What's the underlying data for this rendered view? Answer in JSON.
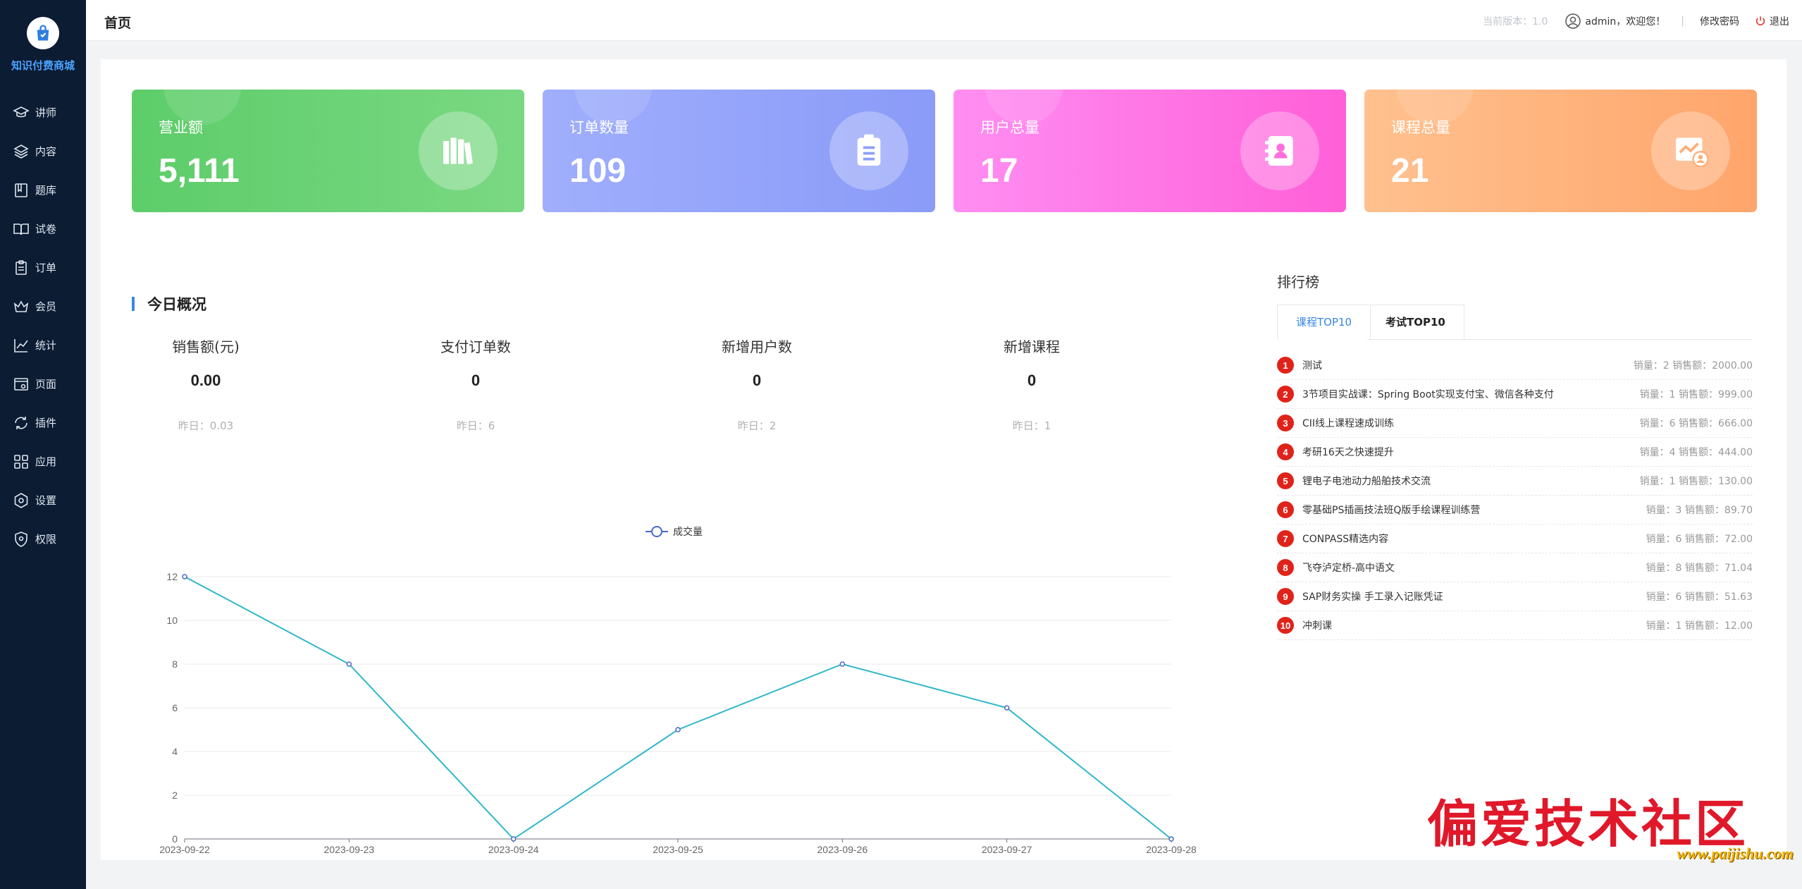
{
  "brand": {
    "name": "知识付费商城"
  },
  "sidebar": {
    "items": [
      {
        "label": "讲师",
        "icon": "graduation-cap-icon"
      },
      {
        "label": "内容",
        "icon": "layers-icon"
      },
      {
        "label": "题库",
        "icon": "book-icon"
      },
      {
        "label": "试卷",
        "icon": "open-book-icon"
      },
      {
        "label": "订单",
        "icon": "clipboard-icon"
      },
      {
        "label": "会员",
        "icon": "crown-icon"
      },
      {
        "label": "统计",
        "icon": "line-chart-icon"
      },
      {
        "label": "页面",
        "icon": "page-settings-icon"
      },
      {
        "label": "插件",
        "icon": "refresh-icon"
      },
      {
        "label": "应用",
        "icon": "apps-grid-icon"
      },
      {
        "label": "设置",
        "icon": "gear-icon"
      },
      {
        "label": "权限",
        "icon": "shield-icon"
      }
    ]
  },
  "header": {
    "title": "首页",
    "version": "当前版本：1.0",
    "user_greeting": "admin，欢迎您！",
    "separator": "|",
    "change_password": "修改密码",
    "logout": "退出"
  },
  "cards": [
    {
      "label": "营业额",
      "value": "5,111",
      "icon": "books-icon"
    },
    {
      "label": "订单数量",
      "value": "109",
      "icon": "clipboard-icon"
    },
    {
      "label": "用户总量",
      "value": "17",
      "icon": "contacts-icon"
    },
    {
      "label": "课程总量",
      "value": "21",
      "icon": "chart-user-icon"
    }
  ],
  "overview": {
    "title": "今日概况",
    "stats": [
      {
        "label": "销售额(元)",
        "value": "0.00",
        "yesterday": "昨日：0.03"
      },
      {
        "label": "支付订单数",
        "value": "0",
        "yesterday": "昨日：6"
      },
      {
        "label": "新增用户数",
        "value": "0",
        "yesterday": "昨日：2"
      },
      {
        "label": "新增课程",
        "value": "0",
        "yesterday": "昨日：1"
      }
    ]
  },
  "chart_data": {
    "type": "line",
    "x": [
      "2023-09-22",
      "2023-09-23",
      "2023-09-24",
      "2023-09-25",
      "2023-09-26",
      "2023-09-27",
      "2023-09-28"
    ],
    "series": [
      {
        "name": "成交量",
        "values": [
          12,
          8,
          0,
          5,
          8,
          6,
          0
        ]
      }
    ],
    "yticks": [
      0,
      2,
      4,
      6,
      8,
      10,
      12
    ],
    "ylim": [
      0,
      12
    ],
    "legend": "top-center",
    "grid": true,
    "color": "#2fb7c9"
  },
  "ranking": {
    "title": "排行榜",
    "tabs": [
      "课程TOP10",
      "考试TOP10"
    ],
    "items": [
      {
        "no": "1",
        "name": "测试",
        "meta": "销量：2 销售额：2000.00"
      },
      {
        "no": "2",
        "name": "3节项目实战课：Spring Boot实现支付宝、微信各种支付",
        "meta": "销量：1 销售额：999.00"
      },
      {
        "no": "3",
        "name": "CII线上课程速成训练",
        "meta": "销量：6 销售额：666.00"
      },
      {
        "no": "4",
        "name": "考研16天之快速提升",
        "meta": "销量：4 销售额：444.00"
      },
      {
        "no": "5",
        "name": "锂电子电池动力船舶技术交流",
        "meta": "销量：1 销售额：130.00"
      },
      {
        "no": "6",
        "name": "零基础PS插画技法班Q版手绘课程训练营",
        "meta": "销量：3 销售额：89.70"
      },
      {
        "no": "7",
        "name": "CONPASS精选内容",
        "meta": "销量：6 销售额：72.00"
      },
      {
        "no": "8",
        "name": "飞夺泸定桥-高中语文",
        "meta": "销量：8 销售额：71.04"
      },
      {
        "no": "9",
        "name": "SAP财务实操 手工录入记账凭证",
        "meta": "销量：6 销售额：51.63"
      },
      {
        "no": "10",
        "name": "冲刺课",
        "meta": "销量：1 销售额：12.00"
      }
    ]
  },
  "watermark": {
    "text": "偏爱技术社区",
    "url": "www.paijishu.com"
  }
}
